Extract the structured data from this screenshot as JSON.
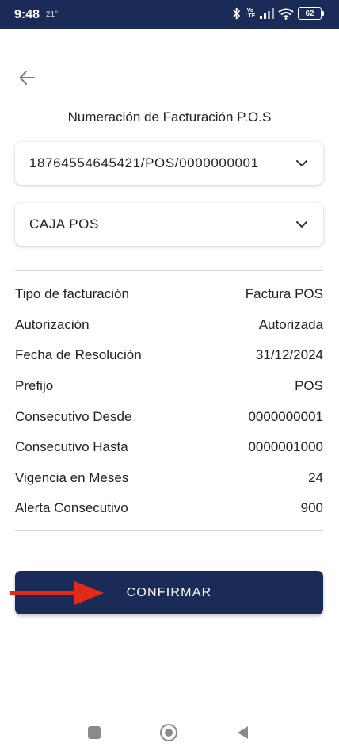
{
  "status_bar": {
    "time": "9:48",
    "temperature": "21°",
    "battery": "62",
    "network_label": "Vo LTE",
    "icons": [
      "bluetooth-icon",
      "volte-icon",
      "signal-icon",
      "wifi-icon",
      "battery-icon"
    ],
    "background": "#1b2b57"
  },
  "header": {
    "back_icon": "arrow-left-icon",
    "title": "Numeración de Facturación P.O.S"
  },
  "selectors": {
    "numeration": {
      "value": "18764554645421/POS/0000000001",
      "icon": "chevron-down-icon"
    },
    "cash_register": {
      "value": "CAJA POS",
      "icon": "chevron-down-icon"
    }
  },
  "details": [
    {
      "label": "Tipo de facturación",
      "value": "Factura POS"
    },
    {
      "label": "Autorización",
      "value": "Autorizada"
    },
    {
      "label": "Fecha de Resolución",
      "value": "31/12/2024"
    },
    {
      "label": "Prefijo",
      "value": "POS"
    },
    {
      "label": "Consecutivo Desde",
      "value": "0000000001"
    },
    {
      "label": "Consecutivo Hasta",
      "value": "0000001000"
    },
    {
      "label": "Vigencia en Meses",
      "value": "24"
    },
    {
      "label": "Alerta Consecutivo",
      "value": "900"
    }
  ],
  "actions": {
    "confirm_label": "CONFIRMAR",
    "confirm_color": "#1b2b57"
  },
  "annotation": {
    "icon": "red-arrow-icon",
    "color": "#e02a1a"
  },
  "nav_bar": {
    "icons": [
      "recents-square-icon",
      "home-circle-icon",
      "back-triangle-icon"
    ]
  }
}
